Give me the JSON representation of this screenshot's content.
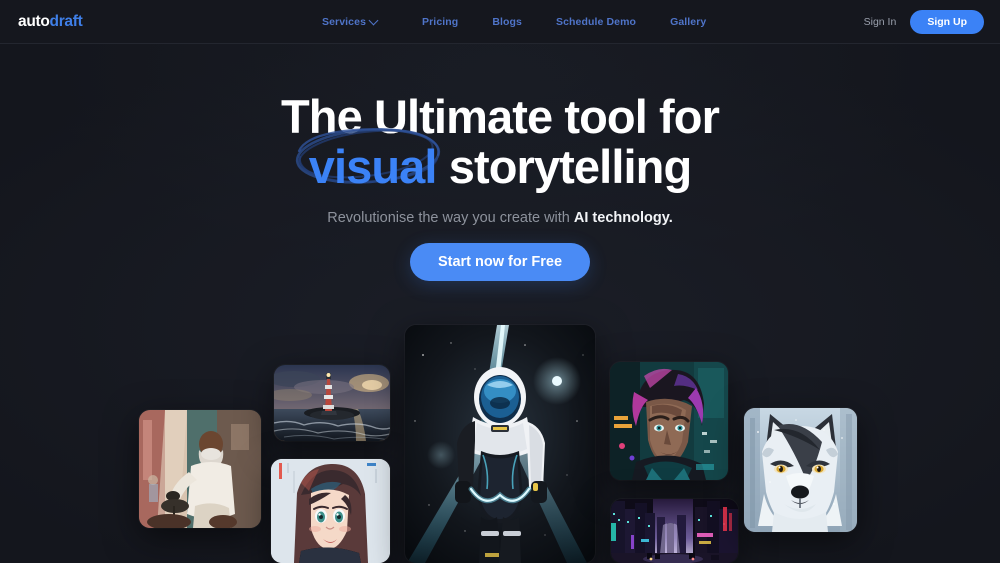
{
  "brand": {
    "name_part1": "auto",
    "name_part2": "draft"
  },
  "nav": {
    "items": [
      {
        "label": "Services",
        "has_dropdown": true,
        "icon": "chevron-down-icon"
      },
      {
        "label": "Pricing",
        "has_dropdown": false
      },
      {
        "label": "Blogs",
        "has_dropdown": false
      },
      {
        "label": "Schedule Demo",
        "has_dropdown": false
      },
      {
        "label": "Gallery",
        "has_dropdown": false
      }
    ]
  },
  "auth": {
    "sign_in": "Sign In",
    "sign_up": "Sign Up"
  },
  "hero": {
    "headline_line1": "The Ultimate tool for",
    "headline_highlight": "visual",
    "headline_rest": " storytelling",
    "subtitle_plain": "Revolutionise the way you create with ",
    "subtitle_bold": "AI technology.",
    "cta_label": "Start now for Free"
  },
  "gallery": {
    "cards": [
      {
        "name": "chai-vendor",
        "alt": "Elderly man pouring chai on a colorful street"
      },
      {
        "name": "lighthouse",
        "alt": "Red lighthouse on rocky island at sunset over ocean"
      },
      {
        "name": "anime-girl",
        "alt": "Anime girl with brown hair and teal eyes"
      },
      {
        "name": "astronaut",
        "alt": "Futuristic astronaut with glowing cyan energy streaks in space"
      },
      {
        "name": "cyberpunk-portrait",
        "alt": "Cyberpunk man with magenta streaked hair on teal background"
      },
      {
        "name": "neon-city",
        "alt": "Neon cyberpunk city street at night"
      },
      {
        "name": "wolf",
        "alt": "White grey wolf with amber eyes in snow"
      }
    ]
  },
  "colors": {
    "background": "#14161d",
    "header_bg": "#15171e",
    "accent_blue": "#3b82f6",
    "cta_blue": "#4a8bf5",
    "nav_blue": "#4f74c9",
    "text_white": "#ffffff",
    "text_muted": "#8d929c"
  }
}
